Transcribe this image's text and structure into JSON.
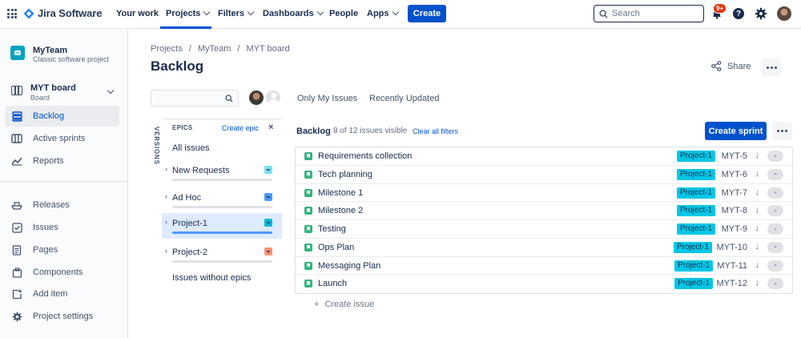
{
  "topnav": {
    "app_name": "Jira Software",
    "items": [
      {
        "label": "Your work",
        "dropdown": false
      },
      {
        "label": "Projects",
        "dropdown": true
      },
      {
        "label": "Filters",
        "dropdown": true
      },
      {
        "label": "Dashboards",
        "dropdown": true
      },
      {
        "label": "People",
        "dropdown": false
      },
      {
        "label": "Apps",
        "dropdown": true
      }
    ],
    "create_label": "Create",
    "search_placeholder": "Search",
    "notification_badge": "9+",
    "help_label": "?"
  },
  "sidebar": {
    "project_name": "MyTeam",
    "project_type": "Classic software project",
    "board_name": "MYT board",
    "board_sub": "Board",
    "items": [
      {
        "label": "Backlog",
        "icon": "backlog-icon",
        "active": true
      },
      {
        "label": "Active sprints",
        "icon": "board-columns-icon",
        "active": false
      },
      {
        "label": "Reports",
        "icon": "reports-icon",
        "active": false
      }
    ],
    "items2": [
      {
        "label": "Releases",
        "icon": "ship-icon"
      },
      {
        "label": "Issues",
        "icon": "issues-icon"
      },
      {
        "label": "Pages",
        "icon": "page-icon"
      },
      {
        "label": "Components",
        "icon": "component-icon"
      },
      {
        "label": "Add item",
        "icon": "add-item-icon"
      },
      {
        "label": "Project settings",
        "icon": "gear-icon"
      }
    ]
  },
  "breadcrumb": [
    "Projects",
    "/",
    "MyTeam",
    "/",
    "MYT board"
  ],
  "page_title": "Backlog",
  "share_label": "Share",
  "filters": {
    "only_my_issues": "Only My Issues",
    "recently_updated": "Recently Updated"
  },
  "versions_label": "VERSIONS",
  "epics": {
    "title": "EPICS",
    "create_label": "Create epic",
    "close": "×",
    "all_issues": "All issues",
    "list": [
      {
        "name": "New Requests",
        "color": "#79e2f2",
        "selected": false
      },
      {
        "name": "Ad Hoc",
        "color": "#4c9aff",
        "selected": false
      },
      {
        "name": "Project-1",
        "color": "#00b8d9",
        "selected": true
      },
      {
        "name": "Project-2",
        "color": "#ff8f73",
        "selected": false
      }
    ],
    "without": "Issues without epics"
  },
  "backlog": {
    "title": "Backlog",
    "count_text": "8 of 12 issues visible",
    "clear_filters": "Clear all filters",
    "create_sprint": "Create sprint",
    "issues": [
      {
        "title": "Requirements collection",
        "epic": "Project-1",
        "key": "MYT-5",
        "estimate": "-"
      },
      {
        "title": "Tech planning",
        "epic": "Project-1",
        "key": "MYT-6",
        "estimate": "-"
      },
      {
        "title": "Milestone 1",
        "epic": "Project-1",
        "key": "MYT-7",
        "estimate": "-"
      },
      {
        "title": "Milestone 2",
        "epic": "Project-1",
        "key": "MYT-8",
        "estimate": "-"
      },
      {
        "title": "Testing",
        "epic": "Project-1",
        "key": "MYT-9",
        "estimate": "-"
      },
      {
        "title": "Ops Plan",
        "epic": "Project-1",
        "key": "MYT-10",
        "estimate": "-"
      },
      {
        "title": "Messaging Plan",
        "epic": "Project-1",
        "key": "MYT-11",
        "estimate": "-"
      },
      {
        "title": "Launch",
        "epic": "Project-1",
        "key": "MYT-12",
        "estimate": "-"
      }
    ],
    "create_issue": "Create issue",
    "create_plus": "+"
  },
  "colors": {
    "accent": "#0052cc",
    "epic_pill": "#00c7e6",
    "story": "#36b37e"
  }
}
